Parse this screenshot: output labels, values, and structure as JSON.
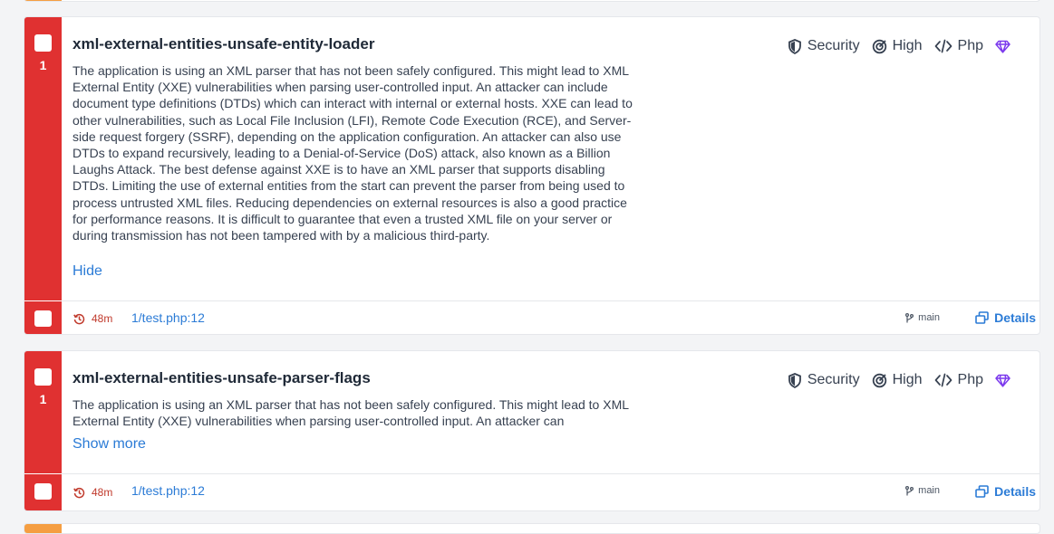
{
  "findings": [
    {
      "count": "1",
      "title": "xml-external-entities-unsafe-entity-loader",
      "description": "The application is using an XML parser that has not been safely configured. This might lead to XML External Entity (XXE) vulnerabilities when parsing user-controlled input. An attacker can include document type definitions (DTDs) which can interact with internal or external hosts. XXE can lead to other vulnerabilities, such as Local File Inclusion (LFI), Remote Code Execution (RCE), and Server-side request forgery (SSRF), depending on the application configuration. An attacker can also use DTDs to expand recursively, leading to a Denial-of-Service (DoS) attack, also known as a Billion Laughs Attack. The best defense against XXE is to have an XML parser that supports disabling DTDs. Limiting the use of external entities from the start can prevent the parser from being used to process untrusted XML files. Reducing dependencies on external resources is also a good practice for performance reasons. It is difficult to guarantee that even a trusted XML file on your server or during transmission has not been tampered with by a malicious third-party.",
      "toggle_label": "Hide",
      "category": "Security",
      "confidence": "High",
      "language": "Php",
      "age": "48m",
      "location": "1/test.php:12",
      "branch": "main",
      "details_label": "Details"
    },
    {
      "count": "1",
      "title": "xml-external-entities-unsafe-parser-flags",
      "description": "The application is using an XML parser that has not been safely configured. This might lead to XML External Entity (XXE) vulnerabilities when parsing user-controlled input. An attacker can",
      "toggle_label": "Show more",
      "category": "Security",
      "confidence": "High",
      "language": "Php",
      "age": "48m",
      "location": "1/test.php:12",
      "branch": "main",
      "details_label": "Details"
    }
  ],
  "colors": {
    "severity_high": "#e03131",
    "severity_medium": "#f59e42",
    "link": "#2b7bd6",
    "pro_badge": "#7c3aed"
  },
  "icons": {
    "category": "shield-icon",
    "confidence": "target-icon",
    "language": "code-icon",
    "pro": "gem-icon",
    "age": "history-icon",
    "branch": "git-branch-icon",
    "details": "windows-icon"
  }
}
